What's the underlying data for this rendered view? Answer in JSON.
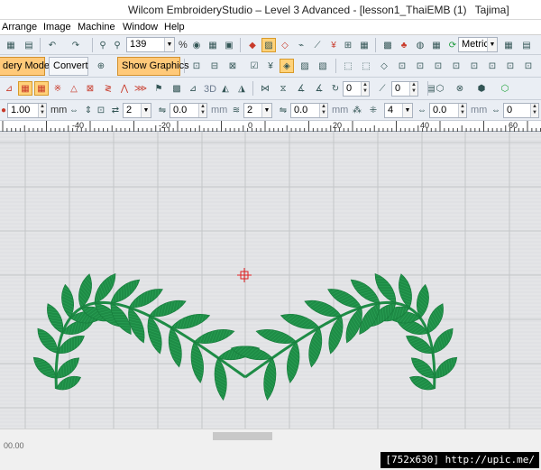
{
  "window": {
    "title_segments": [
      "Wilcom EmbroideryStudio – Level 3 Advanced - [lesson1_ThaiEMB (1)",
      "Tajima]"
    ]
  },
  "menu": [
    "Arrange",
    "Image",
    "Machine",
    "Window",
    "Help"
  ],
  "toolbar1": {
    "zoom_value": "139",
    "percent": "%",
    "units_value": "Metric"
  },
  "toolbar2": {
    "mode_label": "dery Mode",
    "convert_label": "Convert",
    "show_graphics_label": "Show Graphics"
  },
  "toolbar3": {
    "label_3d": "3D",
    "field_a": "0",
    "field_b": "0"
  },
  "toolbar4": {
    "size_value": "1.00",
    "size_unit": "mm",
    "field_2a": "2",
    "field_0a": "0.0",
    "mm_a": "mm",
    "field_2b": "2",
    "field_0b": "0.0",
    "mm_b": "mm",
    "field_4": "4",
    "field_0c": "0.0",
    "mm_c": "mm",
    "field_0d": "0"
  },
  "ruler": {
    "labels": [
      "-40",
      "-20",
      "0",
      "20",
      "40",
      "60"
    ]
  },
  "status": {
    "text": "00.00"
  },
  "watermark": "[752x630] http://upic.me/",
  "colors": {
    "leaf_green": "#1e8c46",
    "grid": "#c4c6c9",
    "canvas": "#e6e7e9",
    "highlight": "#ffc979"
  }
}
